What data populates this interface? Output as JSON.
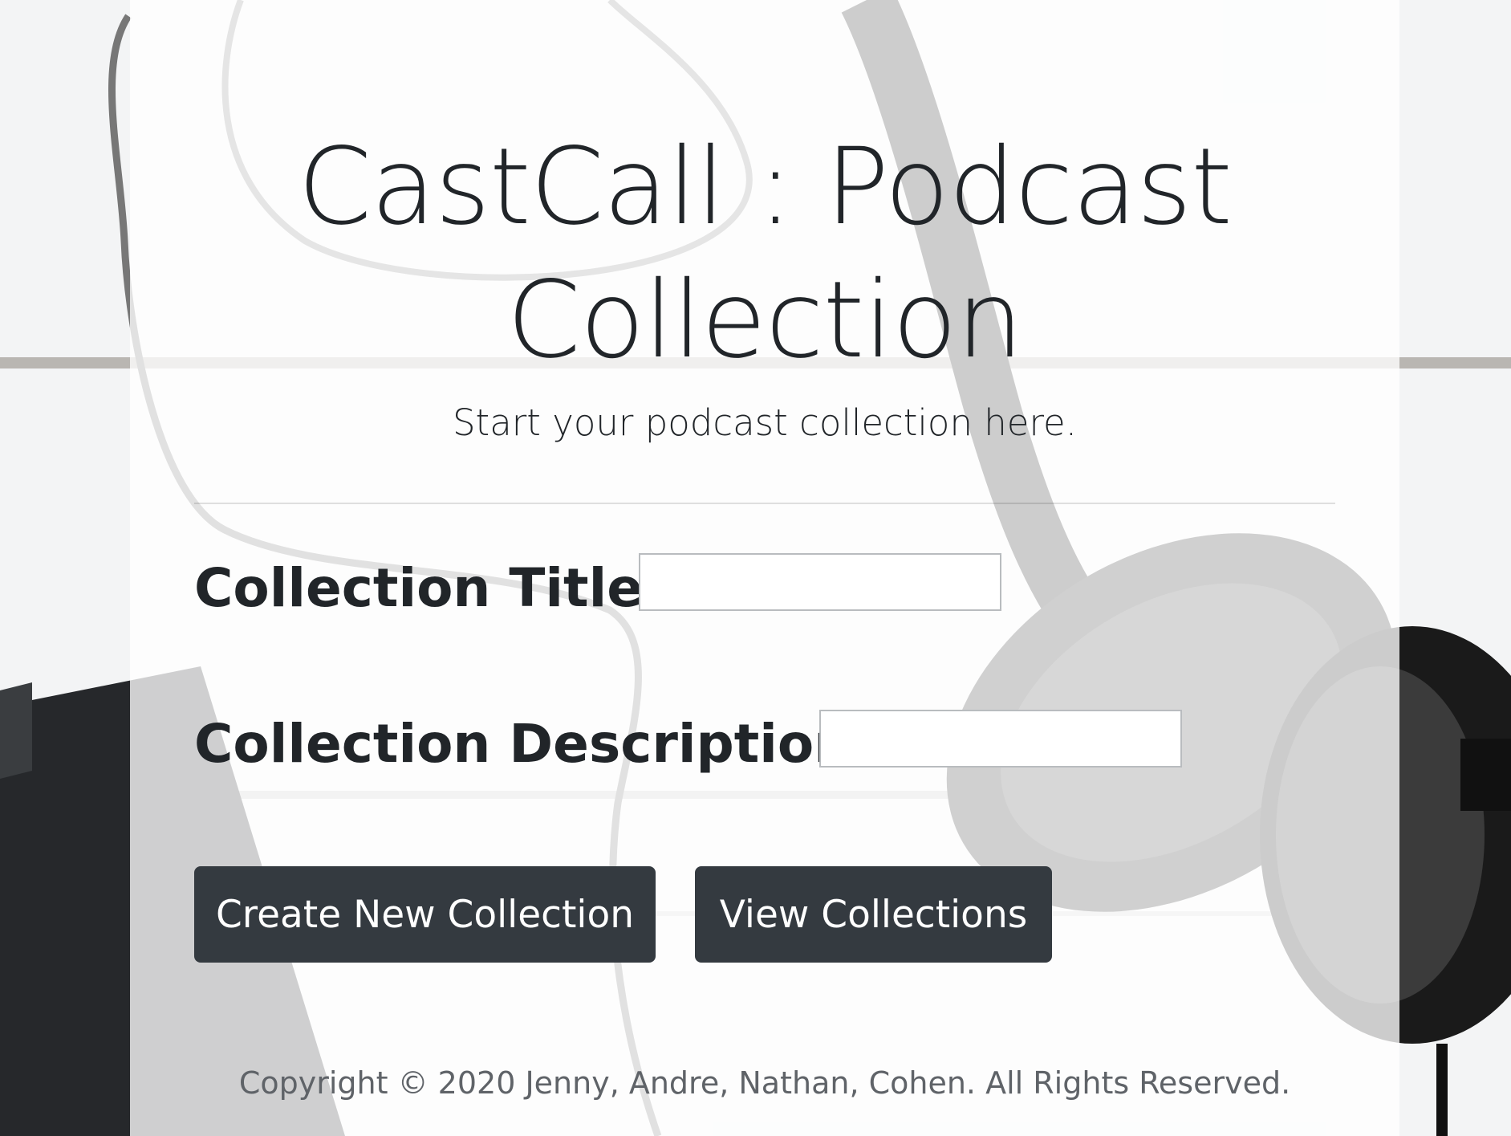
{
  "header": {
    "title": "CastCall : Podcast Collection",
    "lead": "Start your podcast collection here."
  },
  "form": {
    "title_label": "Collection Title:",
    "title_value": "",
    "description_label": "Collection Description:",
    "description_value": ""
  },
  "buttons": {
    "create": "Create New Collection",
    "view": "View Collections"
  },
  "footer": {
    "copyright": "Copyright © 2020 Jenny, Andre, Nathan, Cohen. All Rights Reserved."
  },
  "colors": {
    "button_bg": "#343a40",
    "text": "#212529",
    "footer_text": "#5f6368"
  }
}
